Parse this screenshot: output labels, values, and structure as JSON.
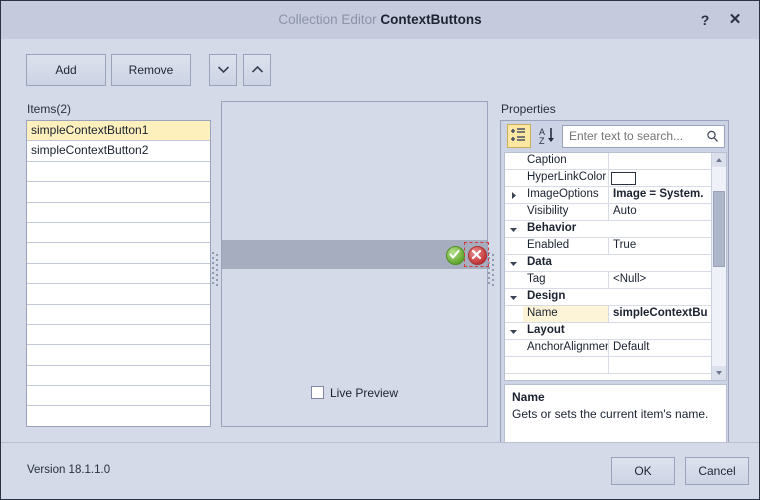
{
  "window": {
    "title_prefix": "Collection Editor",
    "title_main": "ContextButtons",
    "help_glyph": "?",
    "close_glyph": "✕"
  },
  "toolbar": {
    "add_label": "Add",
    "remove_label": "Remove",
    "move_down_glyph": "⌄",
    "move_up_glyph": "⌃"
  },
  "items_panel": {
    "label": "Items(2)",
    "rows": [
      {
        "text": "simpleContextButton1",
        "selected": true
      },
      {
        "text": "simpleContextButton2",
        "selected": false
      },
      {
        "text": "",
        "selected": false
      },
      {
        "text": "",
        "selected": false
      },
      {
        "text": "",
        "selected": false
      },
      {
        "text": "",
        "selected": false
      },
      {
        "text": "",
        "selected": false
      },
      {
        "text": "",
        "selected": false
      },
      {
        "text": "",
        "selected": false
      },
      {
        "text": "",
        "selected": false
      },
      {
        "text": "",
        "selected": false
      },
      {
        "text": "",
        "selected": false
      },
      {
        "text": "",
        "selected": false
      },
      {
        "text": "",
        "selected": false
      },
      {
        "text": "",
        "selected": false
      }
    ]
  },
  "preview_panel": {
    "ok_icon": "green-check-circle-icon",
    "cancel_icon": "red-close-circle-icon",
    "live_preview_label": "Live Preview",
    "live_preview_checked": false
  },
  "properties_panel": {
    "label": "Properties",
    "categorize_icon": "categorize-icon",
    "sort_icon": "sort-alphabetical-icon",
    "search_placeholder": "Enter text to search...",
    "search_value": "",
    "search_icon": "search-icon",
    "rows": [
      {
        "kind": "prop",
        "name": "Caption",
        "value": ""
      },
      {
        "kind": "color",
        "name": "HyperLinkColor",
        "value": "",
        "swatch": "#ffffff"
      },
      {
        "kind": "prop",
        "name": "ImageOptions",
        "value": "Image = System.",
        "bold": true,
        "expandable": true
      },
      {
        "kind": "prop",
        "name": "Visibility",
        "value": "Auto"
      },
      {
        "kind": "category",
        "name": "Behavior",
        "value": ""
      },
      {
        "kind": "prop",
        "name": "Enabled",
        "value": "True"
      },
      {
        "kind": "category",
        "name": "Data",
        "value": ""
      },
      {
        "kind": "prop",
        "name": "Tag",
        "value": "<Null>"
      },
      {
        "kind": "category",
        "name": "Design",
        "value": ""
      },
      {
        "kind": "prop",
        "name": "Name",
        "value": "simpleContextBu",
        "bold": true,
        "highlight": true
      },
      {
        "kind": "category",
        "name": "Layout",
        "value": ""
      },
      {
        "kind": "prop",
        "name": "AnchorAlignment",
        "value": "Default"
      },
      {
        "kind": "prop",
        "name": "",
        "value": ""
      }
    ],
    "scrollbar": {
      "up_glyph": "▲",
      "down_glyph": "▼"
    },
    "description": {
      "title": "Name",
      "text": "Gets or sets the current item's name."
    }
  },
  "footer": {
    "version": "Version 18.1.1.0",
    "ok_label": "OK",
    "cancel_label": "Cancel"
  },
  "colors": {
    "titlebar": "#c5cadd",
    "dialog": "#d4dae8",
    "selection_yellow": "#fdf0bd",
    "accent_green": "#63a830",
    "accent_red": "#c23a3a"
  }
}
